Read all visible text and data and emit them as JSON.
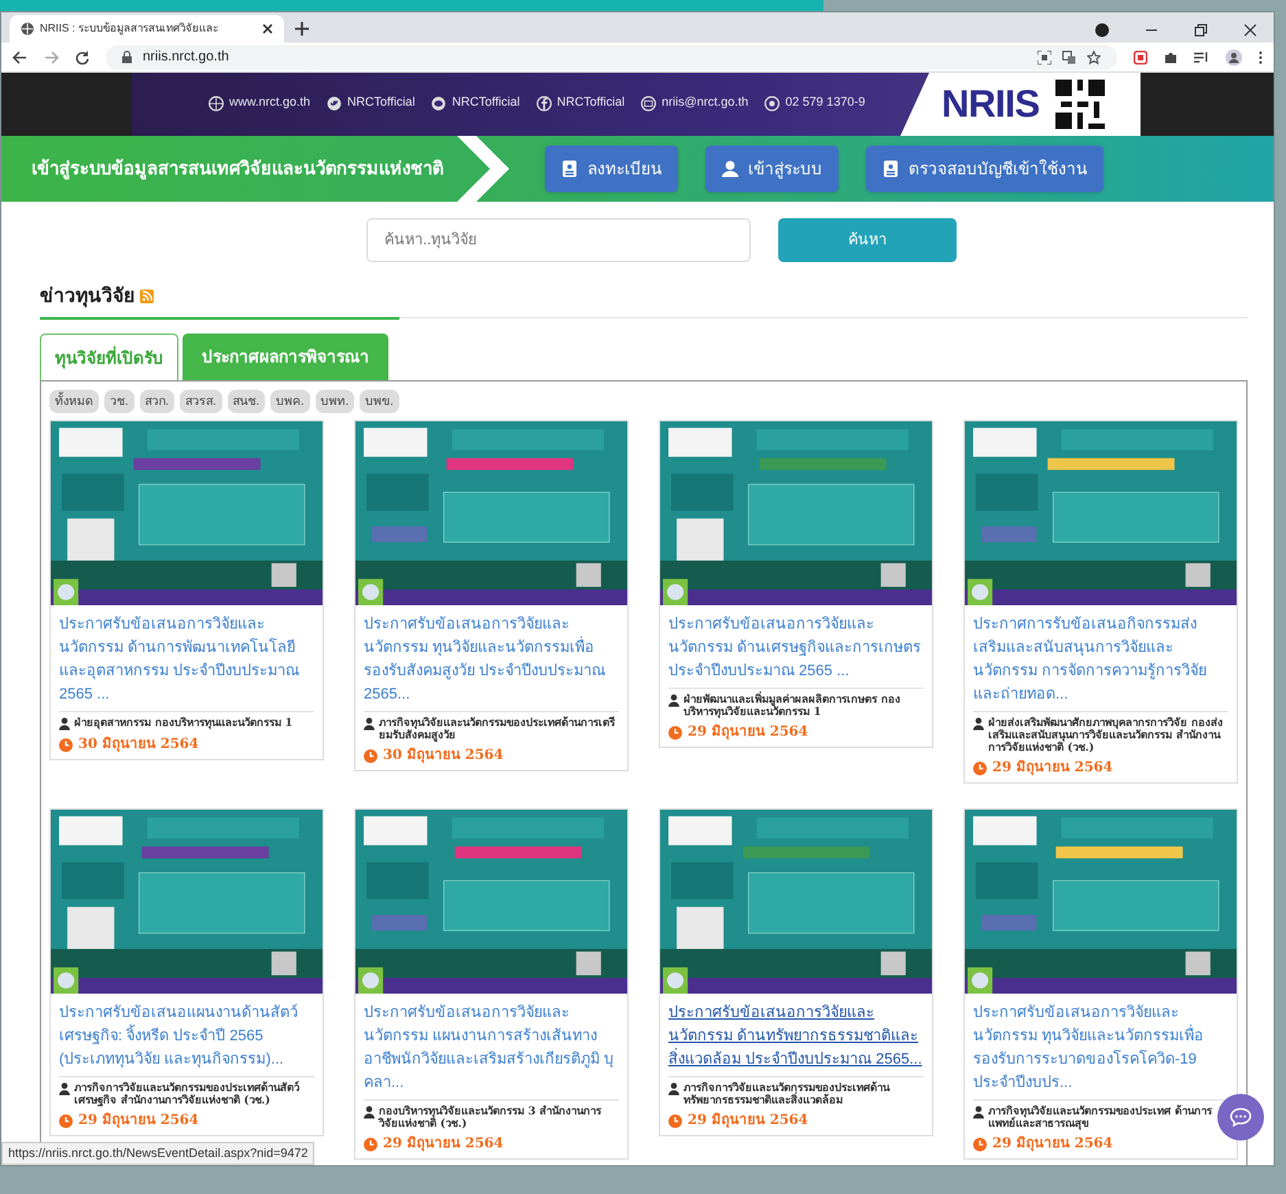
{
  "browser": {
    "tab_title": "NRIIS : ระบบข้อมูลสารสนเทศวิจัยและ",
    "url": "nriis.nrct.go.th",
    "status_url": "https://nriis.nrct.go.th/NewsEventDetail.aspx?nid=9472"
  },
  "banner": {
    "contacts": [
      {
        "kind": "web",
        "text": "www.nrct.go.th"
      },
      {
        "kind": "bird",
        "text": "NRCTofficial"
      },
      {
        "kind": "chat",
        "text": "NRCTofficial"
      },
      {
        "kind": "social",
        "text": "NRCTofficial"
      },
      {
        "kind": "mail",
        "text": "nriis@nrct.go.th"
      },
      {
        "kind": "phone",
        "text": "02 579 1370-9"
      }
    ],
    "logo": "NRIIS"
  },
  "header": {
    "title": "เข้าสู่ระบบข้อมูลสารสนเทศวิจัยและนวัตกรรมแห่งชาติ",
    "buttons": [
      {
        "kind": "card",
        "label": "ลงทะเบียน"
      },
      {
        "kind": "user",
        "label": "เข้าสู่ระบบ"
      },
      {
        "kind": "card",
        "label": "ตรวจสอบบัญชีเข้าใช้งาน"
      }
    ]
  },
  "search": {
    "placeholder": "ค้นหา..ทุนวิจัย",
    "button": "ค้นหา"
  },
  "section": {
    "title": "ข่าวทุนวิจัย"
  },
  "tabs": [
    {
      "label": "ทุนวิจัยที่เปิดรับ",
      "selected": true
    },
    {
      "label": "ประกาศผลการพิจารณา",
      "selected": false
    }
  ],
  "filters": [
    "ทั้งหมด",
    "วช.",
    "สวก.",
    "สวรส.",
    "สนช.",
    "บพค.",
    "บพท.",
    "บพข."
  ],
  "cards": [
    {
      "title": "ประกาศรับข้อเสนอการวิจัยและนวัตกรรม ด้านการพัฒนาเทคโนโลยีและอุตสาหกรรม ประจำปีงบประมาณ 2565 ...",
      "org": "ฝ่ายอุตสาหกรรม กองบริหารทุนและนวัตกรรม 1",
      "date": "30 มิถุนายน 2564",
      "hovered": false
    },
    {
      "title": "ประกาศรับข้อเสนอการวิจัยและนวัตกรรม ทุนวิจัยและนวัตกรรมเพื่อรองรับสังคมสูงวัย ประจำปีงบประมาณ 2565...",
      "org": "ภารกิจทุนวิจัยและนวัตกรรมของประเทศด้านการเตรียมรับสังคมสูงวัย",
      "date": "30 มิถุนายน 2564",
      "hovered": false
    },
    {
      "title": "ประกาศรับข้อเสนอการวิจัยและนวัตกรรม ด้านเศรษฐกิจและการเกษตร ประจำปีงบประมาณ 2565 ...",
      "org": "ฝ่ายพัฒนาและเพิ่มมูลค่าผลผลิตการเกษตร กองบริหารทุนวิจัยและนวัตกรรม 1",
      "date": "29 มิถุนายน 2564",
      "hovered": false
    },
    {
      "title": "ประกาศการรับข้อเสนอกิจกรรมส่งเสริมและสนับสนุนการวิจัยและนวัตกรรม การจัดการความรู้การวิจัยและถ่ายทอด...",
      "org": "ฝ่ายส่งเสริมพัฒนาศักยภาพบุคลากรการวิจัย กองส่งเสริมและสนับสนุนการวิจัยและนวัตกรรม สำนักงานการวิจัยแห่งชาติ (วช.)",
      "date": "29 มิถุนายน 2564",
      "hovered": false
    },
    {
      "title": "ประกาศรับข้อเสนอแผนงานด้านสัตว์เศรษฐกิจ: จิ้งหรีด ประจำปี 2565 (ประเภททุนวิจัย และทุนกิจกรรม)...",
      "org": "ภารกิจการวิจัยและนวัตกรรมของประเทศด้านสัตว์เศรษฐกิจ สำนักงานการวิจัยแห่งชาติ (วช.)",
      "date": "29 มิถุนายน 2564",
      "hovered": false
    },
    {
      "title": "ประกาศรับข้อเสนอการวิจัยและนวัตกรรม แผนงานการสร้างเส้นทางอาชีพนักวิจัยและเสริมสร้างเกียรติภูมิ บุคลา...",
      "org": "กองบริหารทุนวิจัยและนวัตกรรม 3 สำนักงานการวิจัยแห่งชาติ (วช.)",
      "date": "29 มิถุนายน 2564",
      "hovered": false
    },
    {
      "title": "ประกาศรับข้อเสนอการวิจัยและนวัตกรรม ด้านทรัพยากรธรรมชาติและสิ่งแวดล้อม ประจำปีงบประมาณ 2565...",
      "org": "ภารกิจการวิจัยและนวัตกรรมของประเทศด้านทรัพยากรธรรมชาติและสิ่งแวดล้อม",
      "date": "29 มิถุนายน 2564",
      "hovered": true
    },
    {
      "title": "ประกาศรับข้อเสนอการวิจัยและนวัตกรรม ทุนวิจัยและนวัตกรรมเพื่อรองรับการระบาดของโรคโควิด-19 ประจำปีงบปร...",
      "org": "ภารกิจทุนวิจัยและนวัตกรรมของประเทศ ด้านการแพทย์และสาธารณสุข",
      "date": "29 มิถุนายน 2564",
      "hovered": false
    }
  ]
}
